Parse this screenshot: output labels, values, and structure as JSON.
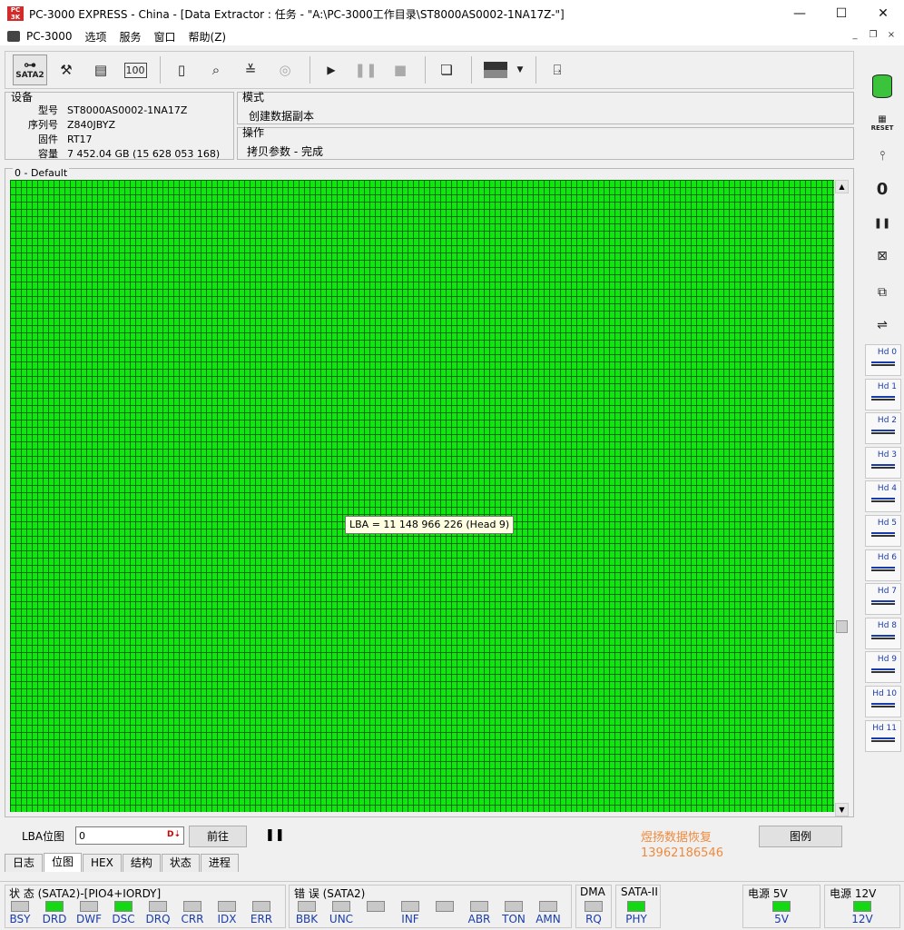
{
  "window": {
    "app_icon": "pc3000-logo",
    "title": "PC-3000 EXPRESS - China - [Data Extractor : 任务 - \"A:\\PC-3000工作目录\\ST8000AS0002-1NA17Z-\"]",
    "minimize": "—",
    "maximize": "☐",
    "close": "✕"
  },
  "menu": {
    "items": [
      "PC-3000",
      "选项",
      "服务",
      "窗口",
      "帮助(Z)"
    ],
    "mdi_minimize": "_",
    "mdi_restore": "❐",
    "mdi_close": "×"
  },
  "toolbar": {
    "sata_label": "SATA2"
  },
  "device": {
    "section_title": "设备",
    "model_label": "型号",
    "model_value": "ST8000AS0002-1NA17Z",
    "serial_label": "序列号",
    "serial_value": "Z840JBYZ",
    "firmware_label": "固件",
    "firmware_value": "RT17",
    "capacity_label": "容量",
    "capacity_value": "7 452.04 GB (15 628 053 168)"
  },
  "mode": {
    "section_title": "模式",
    "value": "创建数据副本"
  },
  "operation": {
    "section_title": "操作",
    "value": "拷贝参数 - 完成"
  },
  "map": {
    "title": "0 - Default",
    "tooltip": "LBA = 11 148 966 226 (Head 9)",
    "block_color": "#0fe80f",
    "grid_color": "#0a6a0a"
  },
  "controls": {
    "lba_label": "LBA位图",
    "lba_value": "0",
    "go_button": "前往",
    "legend_button": "图例"
  },
  "watermark": {
    "line1": "煜扬数据恢复",
    "line2": "13962186546"
  },
  "tabs": [
    "日志",
    "位图",
    "HEX",
    "结构",
    "状态",
    "进程"
  ],
  "active_tab": 1,
  "status": {
    "title": "状 态 (SATA2)-[PIO4+IORDY]",
    "leds": [
      {
        "label": "BSY",
        "on": false
      },
      {
        "label": "DRD",
        "on": true
      },
      {
        "label": "DWF",
        "on": false
      },
      {
        "label": "DSC",
        "on": true
      },
      {
        "label": "DRQ",
        "on": false
      },
      {
        "label": "CRR",
        "on": false
      },
      {
        "label": "IDX",
        "on": false
      },
      {
        "label": "ERR",
        "on": false
      }
    ]
  },
  "error": {
    "title": "错 误 (SATA2)",
    "leds": [
      {
        "label": "BBK",
        "on": false
      },
      {
        "label": "UNC",
        "on": false
      },
      {
        "label": "",
        "on": false
      },
      {
        "label": "INF",
        "on": false
      },
      {
        "label": "",
        "on": false
      },
      {
        "label": "ABR",
        "on": false
      },
      {
        "label": "TON",
        "on": false
      },
      {
        "label": "AMN",
        "on": false
      }
    ]
  },
  "dma": {
    "title": "DMA",
    "label": "RQ",
    "on": false
  },
  "sata": {
    "title": "SATA-II",
    "label": "PHY",
    "on": true
  },
  "power5": {
    "title": "电源 5V",
    "label": "5V",
    "on": true
  },
  "power12": {
    "title": "电源 12V",
    "label": "12V",
    "on": true
  },
  "right_panel": {
    "reset_label": "RESET",
    "heads": [
      "Hd 0",
      "Hd 1",
      "Hd 2",
      "Hd 3",
      "Hd 4",
      "Hd 5",
      "Hd 6",
      "Hd 7",
      "Hd 8",
      "Hd 9",
      "Hd 10",
      "Hd 11"
    ]
  }
}
